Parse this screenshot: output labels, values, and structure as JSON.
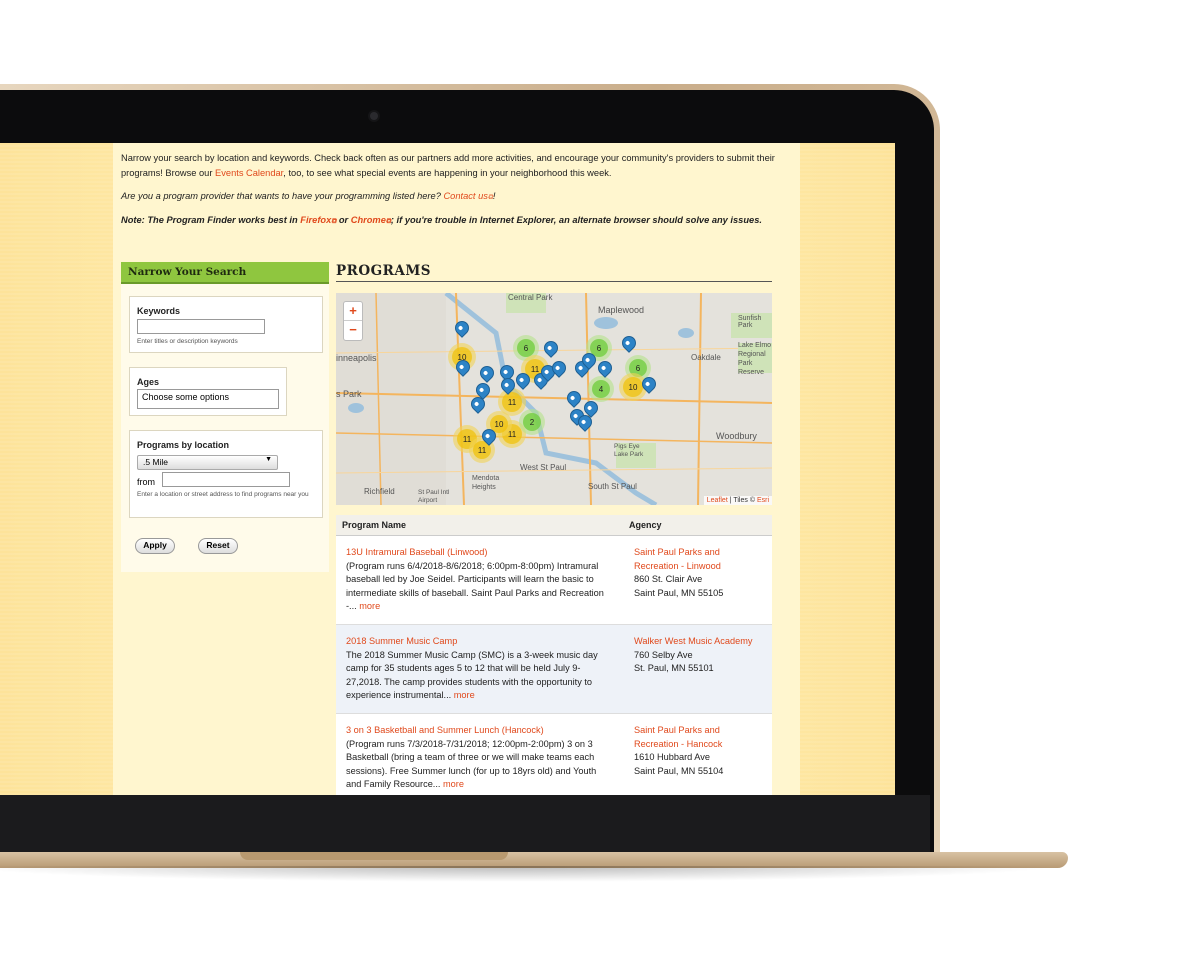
{
  "intro": {
    "p1_a": "Narrow your search by location and keywords. Check back often as our partners add more activities, and encourage your community's providers to submit their programs! Browse our ",
    "p1_link": "Events Calendar",
    "p1_b": ", too, to see what special events are happening in your neighborhood this week.",
    "p2_a": "Are you a program provider that wants to have your programming listed here? ",
    "p2_link": "Contact us",
    "p2_b": "!",
    "p3_a": "Note: The Program Finder works best in ",
    "p3_link1": "Firefox",
    "p3_mid": " or ",
    "p3_link2": "Chrome",
    "p3_b": "; if you're trouble in Internet Explorer, an alternate browser should solve any issues."
  },
  "sidebar": {
    "title": "Narrow Your Search",
    "keywords_label": "Keywords",
    "keywords_value": "",
    "keywords_hint": "Enter titles or description keywords",
    "ages_label": "Ages",
    "ages_placeholder": "Choose some options",
    "location_label": "Programs by location",
    "distance_value": ".5 Mile",
    "from_label": "from",
    "from_value": "",
    "location_hint": "Enter a location or street address to find programs near you",
    "apply_label": "Apply",
    "reset_label": "Reset"
  },
  "programs": {
    "title": "PROGRAMS",
    "map": {
      "zoom_in": "+",
      "zoom_out": "−",
      "attribution_link": "Leaflet",
      "attribution_text": " | Tiles © ",
      "attribution_link2": "Esri",
      "place_labels": [
        "Central Park",
        "Maplewood",
        "Sunfish Park",
        "Lake Elmo Regional Park Reserve",
        "Oakdale",
        "inneapolis",
        "s Park",
        "Woodbury",
        "West St Paul",
        "South St Paul",
        "Mendota Heights",
        "Richfield",
        "Pigs Eye Lake Park",
        "St Paul Intl Airport"
      ],
      "clusters": [
        "10",
        "6",
        "6",
        "6",
        "11",
        "11",
        "11",
        "4",
        "10",
        "10",
        "11",
        "11",
        "2"
      ]
    },
    "table": {
      "col_name": "Program Name",
      "col_agency": "Agency",
      "rows": [
        {
          "title": "13U Intramural Baseball (Linwood)",
          "desc": "(Program runs 6/4/2018-8/6/2018; 6:00pm-8:00pm) Intramural baseball led by Joe Seidel. Participants will learn the basic to intermediate skills of baseball. Saint Paul Parks and Recreation -... ",
          "more": "more",
          "agency": "Saint Paul Parks and Recreation - Linwood",
          "address1": "860 St. Clair Ave",
          "address2": "Saint Paul, MN 55105"
        },
        {
          "title": "2018 Summer Music Camp",
          "desc": "The 2018 Summer Music Camp (SMC) is a 3-week music day camp for 35 students ages 5 to 12 that will be held July 9-27,2018. The camp provides students with the opportunity to experience instrumental... ",
          "more": "more",
          "agency": "Walker West Music Academy",
          "address1": "760 Selby Ave",
          "address2": "St. Paul, MN 55101"
        },
        {
          "title": "3 on 3 Basketball and Summer Lunch (Hancock)",
          "desc": "(Program runs 7/3/2018-7/31/2018; 12:00pm-2:00pm) 3 on 3 Basketball (bring a team of three or we will make teams each sessions). Free Summer lunch (for up to 18yrs old) and Youth and Family Resource... ",
          "more": "more",
          "agency": "Saint Paul Parks and Recreation - Hancock",
          "address1": "1610 Hubbard Ave",
          "address2": "Saint Paul, MN 55104"
        }
      ]
    }
  }
}
